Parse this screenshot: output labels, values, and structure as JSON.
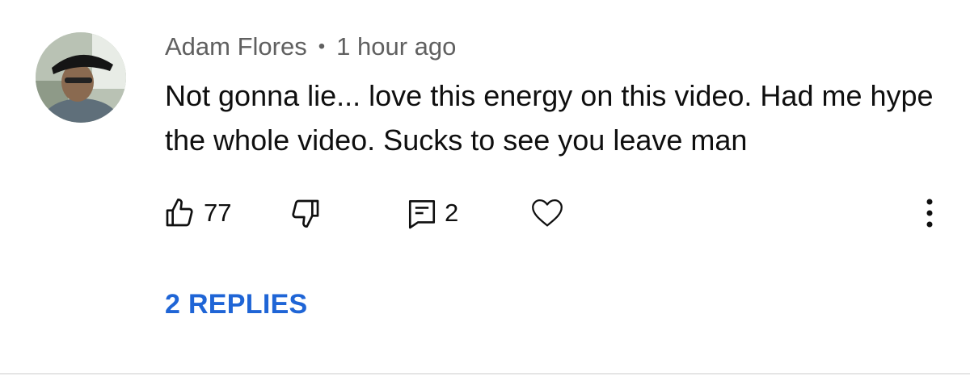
{
  "comment": {
    "author": "Adam Flores",
    "separator": "•",
    "timestamp": "1 hour ago",
    "text": "Not gonna lie... love this energy on this video. Had me hype the whole video. Sucks to see you leave man",
    "likes": "77",
    "reply_count": "2",
    "replies_label": "2 REPLIES"
  },
  "icons": {
    "like": "thumbs-up-icon",
    "dislike": "thumbs-down-icon",
    "reply": "reply-comment-icon",
    "heart": "heart-icon",
    "more": "more-vertical-icon"
  },
  "colors": {
    "text": "#0f0f0f",
    "meta": "#606060",
    "link": "#1f65d6",
    "divider": "#e5e5e5"
  }
}
